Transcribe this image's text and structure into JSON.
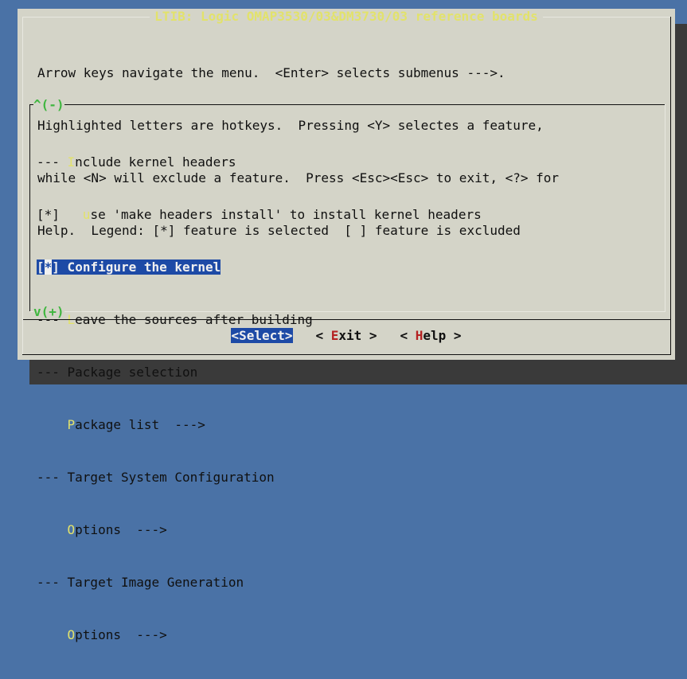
{
  "window": {
    "title": "LTIB: Logic OMAP3530/03&DM3730/03 reference boards"
  },
  "help_lines": [
    "Arrow keys navigate the menu.  <Enter> selects submenus --->.",
    "Highlighted letters are hotkeys.  Pressing <Y> selectes a feature,",
    "while <N> will exclude a feature.  Press <Esc><Esc> to exit, <?> for",
    "Help.  Legend: [*] feature is selected  [ ] feature is excluded"
  ],
  "scroll": {
    "up": "^(-)",
    "down": "v(+)"
  },
  "menu_items": [
    {
      "prefix": "--- ",
      "hotkey": "I",
      "rest": "nclude kernel headers"
    },
    {
      "prefix": "[*]   ",
      "hotkey": "u",
      "rest": "se 'make headers install' to install kernel headers"
    },
    {
      "prefix_open": "[",
      "cursor": "*",
      "prefix_close": "] ",
      "hotkey": "C",
      "rest": "onfigure the kernel"
    },
    {
      "prefix": "--- ",
      "hotkey": "L",
      "rest": "eave the sources after building"
    },
    {
      "prefix": "--- ",
      "hotkey": "",
      "rest": "Package selection"
    },
    {
      "prefix": "    ",
      "hotkey": "P",
      "rest": "ackage list  --->"
    },
    {
      "prefix": "--- ",
      "hotkey": "",
      "rest": "Target System Configuration"
    },
    {
      "prefix": "    ",
      "hotkey": "O",
      "rest": "ptions  --->"
    },
    {
      "prefix": "--- ",
      "hotkey": "",
      "rest": "Target Image Generation"
    },
    {
      "prefix": "    ",
      "hotkey": "O",
      "rest": "ptions  --->"
    }
  ],
  "buttons": {
    "select": "<Select>",
    "exit": {
      "open": "< ",
      "hotkey": "E",
      "rest": "xit",
      "close": " >"
    },
    "help": {
      "open": "< ",
      "hotkey": "H",
      "rest": "elp",
      "close": " >"
    }
  },
  "colors": {
    "background": "#4a72a6",
    "dialog": "#d4d4c8",
    "highlight": "#1d4aa6",
    "hotkey": "#e2e26b",
    "button_hotkey": "#b52222",
    "scroll": "#3fb63f"
  }
}
